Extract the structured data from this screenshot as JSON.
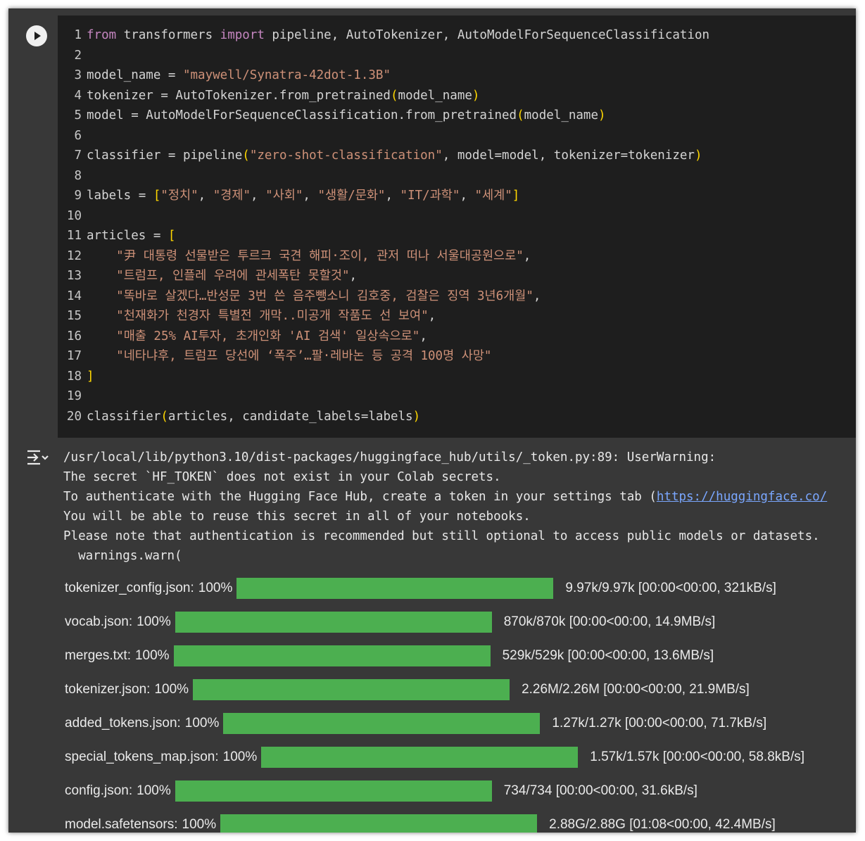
{
  "code": {
    "lines": [
      {
        "n": "1",
        "segs": [
          {
            "t": "from",
            "c": "kw"
          },
          {
            "t": " transformers ",
            "c": ""
          },
          {
            "t": "import",
            "c": "kw"
          },
          {
            "t": " pipeline, AutoTokenizer, AutoModelForSequenceClassification",
            "c": ""
          }
        ]
      },
      {
        "n": "2",
        "segs": []
      },
      {
        "n": "3",
        "segs": [
          {
            "t": "model_name = ",
            "c": ""
          },
          {
            "t": "\"maywell/Synatra-42dot-1.3B\"",
            "c": "str"
          }
        ]
      },
      {
        "n": "4",
        "segs": [
          {
            "t": "tokenizer = AutoTokenizer.from_pretrained",
            "c": ""
          },
          {
            "t": "(",
            "c": "br"
          },
          {
            "t": "model_name",
            "c": ""
          },
          {
            "t": ")",
            "c": "br"
          }
        ]
      },
      {
        "n": "5",
        "segs": [
          {
            "t": "model = AutoModelForSequenceClassification.from_pretrained",
            "c": ""
          },
          {
            "t": "(",
            "c": "br"
          },
          {
            "t": "model_name",
            "c": ""
          },
          {
            "t": ")",
            "c": "br"
          }
        ]
      },
      {
        "n": "6",
        "segs": []
      },
      {
        "n": "7",
        "segs": [
          {
            "t": "classifier = pipeline",
            "c": ""
          },
          {
            "t": "(",
            "c": "br"
          },
          {
            "t": "\"zero-shot-classification\"",
            "c": "str"
          },
          {
            "t": ", model=model, tokenizer=tokenizer",
            "c": ""
          },
          {
            "t": ")",
            "c": "br"
          }
        ]
      },
      {
        "n": "8",
        "segs": []
      },
      {
        "n": "9",
        "segs": [
          {
            "t": "labels = ",
            "c": ""
          },
          {
            "t": "[",
            "c": "br"
          },
          {
            "t": "\"정치\"",
            "c": "str"
          },
          {
            "t": ", ",
            "c": ""
          },
          {
            "t": "\"경제\"",
            "c": "str"
          },
          {
            "t": ", ",
            "c": ""
          },
          {
            "t": "\"사회\"",
            "c": "str"
          },
          {
            "t": ", ",
            "c": ""
          },
          {
            "t": "\"생활/문화\"",
            "c": "str"
          },
          {
            "t": ", ",
            "c": ""
          },
          {
            "t": "\"IT/과학\"",
            "c": "str"
          },
          {
            "t": ", ",
            "c": ""
          },
          {
            "t": "\"세계\"",
            "c": "str"
          },
          {
            "t": "]",
            "c": "br"
          }
        ]
      },
      {
        "n": "10",
        "segs": []
      },
      {
        "n": "11",
        "segs": [
          {
            "t": "articles = ",
            "c": ""
          },
          {
            "t": "[",
            "c": "br"
          }
        ]
      },
      {
        "n": "12",
        "segs": [
          {
            "t": "    ",
            "c": ""
          },
          {
            "t": "\"尹 대통령 선물받은 투르크 국견 해피·조이, 관저 떠나 서울대공원으로\"",
            "c": "str"
          },
          {
            "t": ",",
            "c": ""
          }
        ]
      },
      {
        "n": "13",
        "segs": [
          {
            "t": "    ",
            "c": ""
          },
          {
            "t": "\"트럼프, 인플레 우려에 관세폭탄 못할것\"",
            "c": "str"
          },
          {
            "t": ",",
            "c": ""
          }
        ]
      },
      {
        "n": "14",
        "segs": [
          {
            "t": "    ",
            "c": ""
          },
          {
            "t": "\"똑바로 살겠다…반성문 3번 쓴 음주뺑소니 김호중, 검찰은 징역 3년6개월\"",
            "c": "str"
          },
          {
            "t": ",",
            "c": ""
          }
        ]
      },
      {
        "n": "15",
        "segs": [
          {
            "t": "    ",
            "c": ""
          },
          {
            "t": "\"천재화가 천경자 특별전 개막..미공개 작품도 선 보여\"",
            "c": "str"
          },
          {
            "t": ",",
            "c": ""
          }
        ]
      },
      {
        "n": "16",
        "segs": [
          {
            "t": "    ",
            "c": ""
          },
          {
            "t": "\"매출 25% AI투자, 초개인화 'AI 검색' 일상속으로\"",
            "c": "str"
          },
          {
            "t": ",",
            "c": ""
          }
        ]
      },
      {
        "n": "17",
        "segs": [
          {
            "t": "    ",
            "c": ""
          },
          {
            "t": "\"네타냐후, 트럼프 당선에 ‘폭주’…팔·레바논 등 공격 100명 사망\"",
            "c": "str"
          }
        ]
      },
      {
        "n": "18",
        "segs": [
          {
            "t": "]",
            "c": "br"
          }
        ]
      },
      {
        "n": "19",
        "segs": []
      },
      {
        "n": "20",
        "segs": [
          {
            "t": "classifier",
            "c": ""
          },
          {
            "t": "(",
            "c": "br"
          },
          {
            "t": "articles, candidate_labels=labels",
            "c": ""
          },
          {
            "t": ")",
            "c": "br"
          }
        ]
      }
    ]
  },
  "output": {
    "stderr": [
      "/usr/local/lib/python3.10/dist-packages/huggingface_hub/utils/_token.py:89: UserWarning: ",
      "The secret `HF_TOKEN` does not exist in your Colab secrets.",
      "To authenticate with the Hugging Face Hub, create a token in your settings tab (",
      "You will be able to reuse this secret in all of your notebooks.",
      "Please note that authentication is recommended but still optional to access public models or datasets.",
      "  warnings.warn("
    ],
    "link_text": "https://huggingface.co/",
    "progress": [
      {
        "name": "tokenizer_config.json:",
        "pct": "100%",
        "fraction": 1.0,
        "stat": "9.97k/9.97k [00:00<00:00, 321kB/s]"
      },
      {
        "name": "vocab.json:",
        "pct": "100%",
        "fraction": 1.0,
        "stat": "870k/870k [00:00<00:00, 14.9MB/s]"
      },
      {
        "name": "merges.txt:",
        "pct": "100%",
        "fraction": 1.0,
        "stat": "529k/529k [00:00<00:00, 13.6MB/s]"
      },
      {
        "name": "tokenizer.json:",
        "pct": "100%",
        "fraction": 1.0,
        "stat": "2.26M/2.26M [00:00<00:00, 21.9MB/s]"
      },
      {
        "name": "added_tokens.json:",
        "pct": "100%",
        "fraction": 1.0,
        "stat": "1.27k/1.27k [00:00<00:00, 71.7kB/s]"
      },
      {
        "name": "special_tokens_map.json:",
        "pct": "100%",
        "fraction": 1.0,
        "stat": "1.57k/1.57k [00:00<00:00, 58.8kB/s]"
      },
      {
        "name": "config.json:",
        "pct": "100%",
        "fraction": 1.0,
        "stat": "734/734 [00:00<00:00, 31.6kB/s]"
      },
      {
        "name": "model.safetensors:",
        "pct": "100%",
        "fraction": 1.0,
        "stat": "2.88G/2.88G [01:08<00:00, 42.4MB/s]"
      }
    ]
  },
  "icons": {
    "run": "play-circle-icon",
    "output_toggle": "output-expand-icon"
  },
  "colors": {
    "editor_bg": "#1e1e1e",
    "keyword": "#c586c0",
    "string": "#ce9178",
    "bracket": "#ffd700",
    "progress_bar": "#4caf50",
    "link": "#7aa7ff"
  }
}
